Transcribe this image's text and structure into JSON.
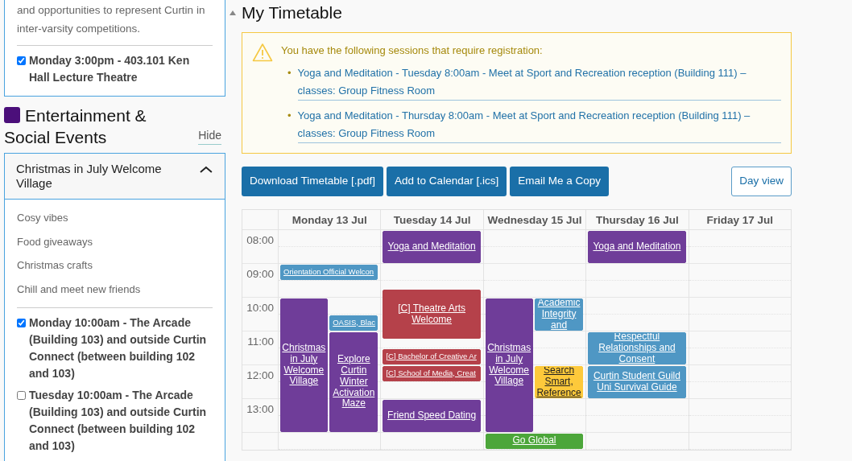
{
  "sidebar": {
    "intro_text": "and opportunities to represent Curtin in inter-varsity competitions.",
    "session": {
      "label": "Monday 3:00pm - 403.101 Ken Hall Lecture Theatre",
      "checked": true
    },
    "category": {
      "title": "Entertainment & Social Events",
      "color": "#4b0f7a",
      "hide_link": "Hide"
    },
    "event": {
      "title": "Christmas in July Welcome Village",
      "expanded": true,
      "features": [
        "Cosy vibes",
        "Food giveaways",
        "Christmas crafts",
        "Chill and meet new friends"
      ],
      "sessions": [
        {
          "label": "Monday 10:00am - The Arcade (Building 103) and outside Curtin Connect (between building 102 and 103)",
          "checked": true
        },
        {
          "label": "Tuesday 10:00am - The Arcade (Building 103) and outside Curtin Connect (between building 102 and 103)",
          "checked": false
        }
      ]
    }
  },
  "timetable": {
    "title": "My Timetable",
    "expanded": true,
    "alert": {
      "message": "You have the following sessions that require registration:",
      "links": [
        {
          "bullet": "•",
          "text": "Yoga and Meditation - Tuesday 8:00am - Meet at Sport and Recreation reception (Building 111) – classes: Group Fitness Room"
        },
        {
          "bullet": "•",
          "text": "Yoga and Meditation - Thursday 8:00am - Meet at Sport and Recreation reception (Building 111) – classes: Group Fitness Room"
        }
      ]
    },
    "buttons": [
      "Download Timetable [.pdf]",
      "Add to Calendar [.ics]",
      "Email Me a Copy"
    ],
    "day_view_button": "Day view",
    "times": [
      "08:00",
      "09:00",
      "10:00",
      "11:00",
      "12:00",
      "13:00"
    ],
    "days": [
      {
        "label": "Monday 13 Jul",
        "events": [
          {
            "title": "Orientation Official Welcon",
            "color": "#4f97c4"
          },
          {
            "title": "Christmas in July Welcome Village",
            "color": "#6f3d99"
          },
          {
            "title": "OASIS, Blac",
            "color": "#4f97c4"
          },
          {
            "title": "Explore Curtin Winter Activation Maze",
            "color": "#6f3d99"
          }
        ]
      },
      {
        "label": "Tuesday 14 Jul",
        "events": [
          {
            "title": "Yoga and Meditation",
            "color": "#6f3d99"
          },
          {
            "title": "[C] Theatre Arts Welcome",
            "color": "#b5414a"
          },
          {
            "title": "[C] Bachelor of Creative Ar",
            "color": "#b5414a"
          },
          {
            "title": "[C] School of Media, Creat",
            "color": "#b5414a"
          },
          {
            "title": "Friend Speed Dating",
            "color": "#6f3d99"
          }
        ]
      },
      {
        "label": "Wednesday 15 Jul",
        "events": [
          {
            "title": "Christmas in July Welcome Village",
            "color": "#6f3d99"
          },
          {
            "title": "Academic Integrity and",
            "color": "#4f97c4"
          },
          {
            "title": "Search Smart, Reference",
            "color": "#fdc93b"
          },
          {
            "title": "Go Global",
            "color": "#4ca63a"
          }
        ]
      },
      {
        "label": "Thursday 16 Jul",
        "events": [
          {
            "title": "Yoga and Meditation",
            "color": "#6f3d99"
          },
          {
            "title": "Respectful Relationships and Consent",
            "color": "#4f97c4"
          },
          {
            "title": "Curtin Student Guild Uni Survival Guide",
            "color": "#4f97c4"
          }
        ]
      },
      {
        "label": "Friday 17 Jul"
      }
    ]
  }
}
